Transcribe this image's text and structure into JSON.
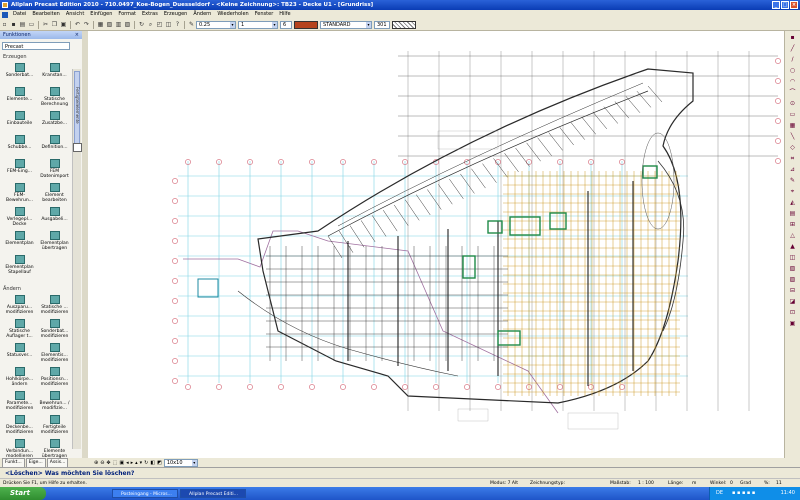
{
  "window": {
    "title": "Allplan Precast Edition 2010 - 710.0497_Koe-Bogen_Duesseldorf - <Keine Zeichnung>: TB23 - Decke U1 - [Grundriss]",
    "buttons": [
      "_",
      "□",
      "×"
    ]
  },
  "menubar": [
    "Datei",
    "Bearbeiten",
    "Ansicht",
    "Einfügen",
    "Format",
    "Extras",
    "Erzeugen",
    "Ändern",
    "Wiederholen",
    "Fenster",
    "Hilfe"
  ],
  "toolbar": {
    "pen": "0.25",
    "line": "1",
    "color_num": "6",
    "layer": "STANDARD",
    "hatch_num": "301"
  },
  "left_panel": {
    "title": "Funktionen",
    "module": "Precast",
    "side_label": "Fertigteilelemente",
    "section_create": "Erzeugen",
    "section_change": "Ändern",
    "create_tools": [
      "Sonderbat...",
      "Kranstan...",
      "Elemente...",
      "Statische Berechnung",
      "Einbauteile",
      "Zusatzbe...",
      "Schubbe...",
      "Definition...",
      "FEM-Eing...",
      "FEM Datenimport",
      "FEM-Bewehrun...",
      "Element bearbeiten",
      "Verlegepl... Decke",
      "Ausgabeli...",
      "Elementplan",
      "Elementplan übertragen",
      "Elementplan Stapellauf"
    ],
    "change_tools": [
      "Auszparu... modifizieren",
      "Statische ... modifizieren",
      "Statische Auflager t...",
      "Sonderbat... modifizieren",
      "Statusver...",
      "Elementis... modifizieren",
      "Hohlkörpe... ändern",
      "Positionsn... modifizieren",
      "Paramete... modifizieren",
      "Bewehrun... / modifizie...",
      "Deckenbe... modifizieren",
      "Fertigteile modifizieren",
      "Verbindun... modellieren",
      "Elemente übertragen"
    ]
  },
  "bottom_tabs": [
    "Funkt...",
    "Eige...",
    "Assis..."
  ],
  "bottom_tools_zoom": "10x10",
  "command_line": "<Löschen> Was möchten Sie löschen?",
  "status": {
    "help": "Drücken Sie F1, um Hilfe zu erhalten.",
    "modus": "Modus: 7 Alt",
    "zeichnungstyp": "Zeichnungstyp:",
    "massstab": "Maßstab:",
    "scale": "1 : 100",
    "laenge": "Länge:",
    "unit": "m",
    "winkel": "Winkel:",
    "winkel_val": "0",
    "grad": "Grad",
    "pct": "%:",
    "pct_val": "11"
  },
  "taskbar": {
    "start": "Start",
    "items": [
      "Posteingang - Micros...",
      "Allplan Precast Editi..."
    ],
    "lang": "DE",
    "clock": "11:40"
  },
  "drawing": {
    "grid_color": "#7fd4e4",
    "axis_color": "#d26070",
    "wall_color": "#2a2a2a",
    "edge_color": "#a070a0",
    "precast_color": "#c89010",
    "highlight_color": "#1e8a48"
  }
}
